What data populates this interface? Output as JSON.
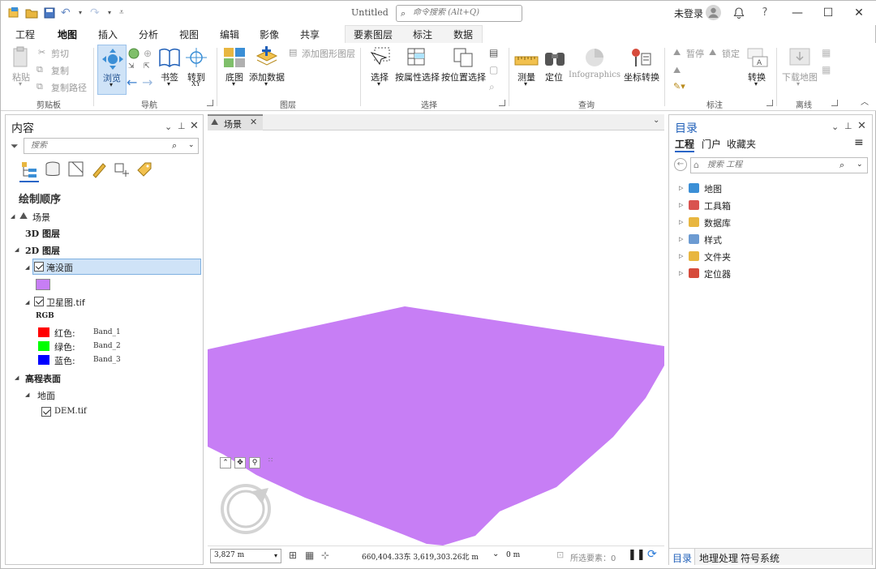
{
  "title_bar": {
    "doc_title": "Untitled",
    "command_search_placeholder": "命令搜索 (Alt+Q)",
    "user_status": "未登录",
    "help": "?",
    "minimize": "—",
    "maximize": "☐",
    "close": "✕"
  },
  "tabs": [
    "工程",
    "地图",
    "插入",
    "分析",
    "视图",
    "编辑",
    "影像",
    "共享",
    "要素图层",
    "标注",
    "数据"
  ],
  "active_tab": "地图",
  "ribbon": {
    "clipboard": {
      "paste": "粘贴",
      "cut": "剪切",
      "copy": "复制",
      "copy_path": "复制路径",
      "label": "剪贴板"
    },
    "navigate": {
      "explore": "浏览",
      "bookmarks": "书签",
      "goto": "转到",
      "goto_sub": "XY",
      "label": "导航"
    },
    "layer": {
      "basemap": "底图",
      "add_data": "添加数据",
      "add_graphics": "添加图形图层",
      "label": "图层"
    },
    "selection": {
      "select": "选择",
      "by_attr": "按属性选择",
      "by_loc": "按位置选择",
      "label": "选择"
    },
    "inquiry": {
      "measure": "测量",
      "locate": "定位",
      "infographics": "Infographics",
      "coord_convert": "坐标转换",
      "label": "查询"
    },
    "labeling": {
      "pause": "暂停",
      "lock": "锁定",
      "convert": "转换",
      "label": "标注"
    },
    "offline": {
      "download": "下载地图",
      "label": "离线"
    }
  },
  "contents_pane": {
    "title": "内容",
    "search_placeholder": "搜索",
    "section_title": "绘制顺序",
    "scene": "场景",
    "layers_3d": "3D 图层",
    "layers_2d": "2D 图层",
    "flood_layer": "淹没面",
    "flood_color": "#c77ef5",
    "raster_layer": "卫星图.tif",
    "rgb": "RGB",
    "bands": [
      {
        "name": "红色:",
        "band": "Band_1",
        "color": "#ff0000"
      },
      {
        "name": "绿色:",
        "band": "Band_2",
        "color": "#00ff00"
      },
      {
        "name": "蓝色:",
        "band": "Band_3",
        "color": "#0000ff"
      }
    ],
    "elevation": "高程表面",
    "ground": "地面",
    "dem": "DEM.tif"
  },
  "view": {
    "tab_label": "场景",
    "scale": "3,827 m",
    "coords": "660,404.33东 3,619,303.26北 m",
    "elevation_readout": "0 m",
    "selected_features": "所选要素：0",
    "polygon_color": "#c77ef5"
  },
  "catalog_pane": {
    "title": "目录",
    "subtabs": [
      "工程",
      "门户",
      "收藏夹"
    ],
    "search_placeholder": "搜索 工程",
    "items": [
      {
        "label": "地图",
        "icon": "map-folder-icon",
        "color": "#3b8fd6"
      },
      {
        "label": "工具箱",
        "icon": "toolbox-icon",
        "color": "#d9534f"
      },
      {
        "label": "数据库",
        "icon": "database-icon",
        "color": "#e8b640"
      },
      {
        "label": "样式",
        "icon": "style-icon",
        "color": "#6c9bd2"
      },
      {
        "label": "文件夹",
        "icon": "folder-icon",
        "color": "#e8b640"
      },
      {
        "label": "定位器",
        "icon": "locator-icon",
        "color": "#d64b3b"
      }
    ],
    "bottom_tabs": [
      "目录",
      "地理处理",
      "符号系统"
    ]
  }
}
